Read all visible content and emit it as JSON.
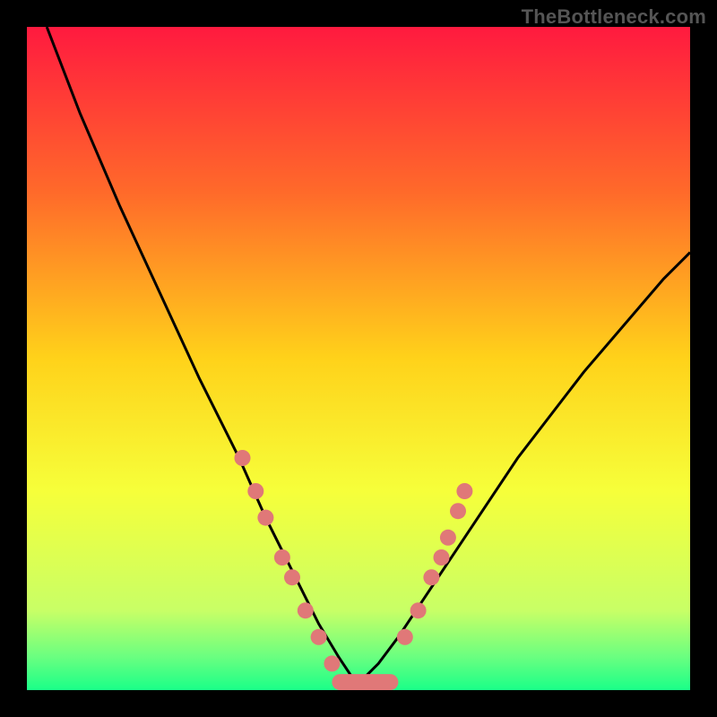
{
  "watermark": "TheBottleneck.com",
  "chart_data": {
    "type": "line",
    "title": "",
    "xlabel": "",
    "ylabel": "",
    "xlim": [
      0,
      100
    ],
    "ylim": [
      0,
      100
    ],
    "gradient_stops": [
      {
        "offset": 0,
        "color": "#ff1a3f"
      },
      {
        "offset": 25,
        "color": "#ff6a2a"
      },
      {
        "offset": 50,
        "color": "#ffd21a"
      },
      {
        "offset": 70,
        "color": "#f6ff3a"
      },
      {
        "offset": 88,
        "color": "#c8ff66"
      },
      {
        "offset": 95,
        "color": "#6aff80"
      },
      {
        "offset": 100,
        "color": "#1aff88"
      }
    ],
    "series": [
      {
        "name": "bottleneck-curve",
        "x": [
          3,
          8,
          14,
          20,
          26,
          32,
          36,
          40,
          44,
          47,
          49,
          51,
          53,
          56,
          60,
          66,
          74,
          84,
          96,
          100
        ],
        "y": [
          100,
          87,
          73,
          60,
          47,
          35,
          26,
          18,
          10,
          5,
          2,
          2,
          4,
          8,
          14,
          23,
          35,
          48,
          62,
          66
        ]
      }
    ],
    "markers": {
      "name": "highlight-dots",
      "color": "#e07878",
      "points": [
        {
          "x": 32.5,
          "y": 35
        },
        {
          "x": 34.5,
          "y": 30
        },
        {
          "x": 36.0,
          "y": 26
        },
        {
          "x": 38.5,
          "y": 20
        },
        {
          "x": 40.0,
          "y": 17
        },
        {
          "x": 42.0,
          "y": 12
        },
        {
          "x": 44.0,
          "y": 8
        },
        {
          "x": 46.0,
          "y": 4
        },
        {
          "x": 57.0,
          "y": 8
        },
        {
          "x": 59.0,
          "y": 12
        },
        {
          "x": 61.0,
          "y": 17
        },
        {
          "x": 62.5,
          "y": 20
        },
        {
          "x": 63.5,
          "y": 23
        },
        {
          "x": 65.0,
          "y": 27
        },
        {
          "x": 66.0,
          "y": 30
        }
      ],
      "bottom_bar": {
        "x0": 46,
        "x1": 56,
        "y": 1.2
      }
    }
  }
}
